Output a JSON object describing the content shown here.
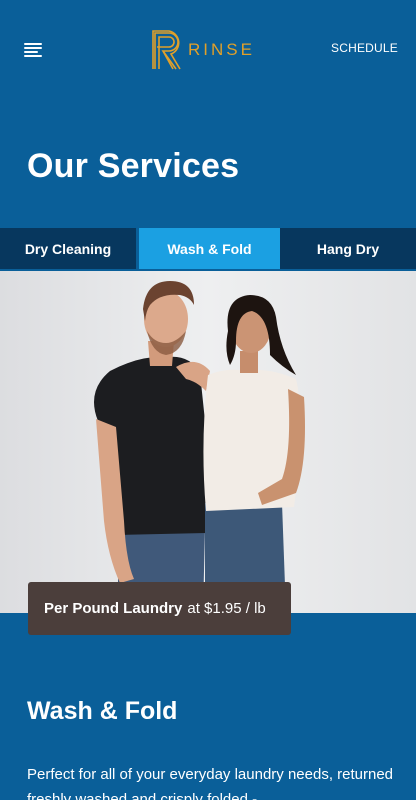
{
  "header": {
    "menu_icon": "hamburger-menu-icon",
    "logo_icon": "rinse-logo-mark",
    "logo_text": "RINSE",
    "schedule_label": "SCHEDULE",
    "brand_color": "#e0a02a"
  },
  "page": {
    "title": "Our Services",
    "background_color": "#0a5f99"
  },
  "tabs": [
    {
      "label": "Dry Cleaning",
      "active": false
    },
    {
      "label": "Wash & Fold",
      "active": true
    },
    {
      "label": "Hang Dry",
      "active": false
    }
  ],
  "tab_colors": {
    "active": "#1ba0e2",
    "inactive": "#07375e"
  },
  "hero": {
    "image_subject": "couple-photo",
    "badge_strong": "Per Pound Laundry",
    "badge_price": "at $1.95 / lb"
  },
  "section": {
    "title": "Wash & Fold",
    "description": "Perfect for all of your everyday laundry needs, returned freshly washed and crisply folded -"
  }
}
